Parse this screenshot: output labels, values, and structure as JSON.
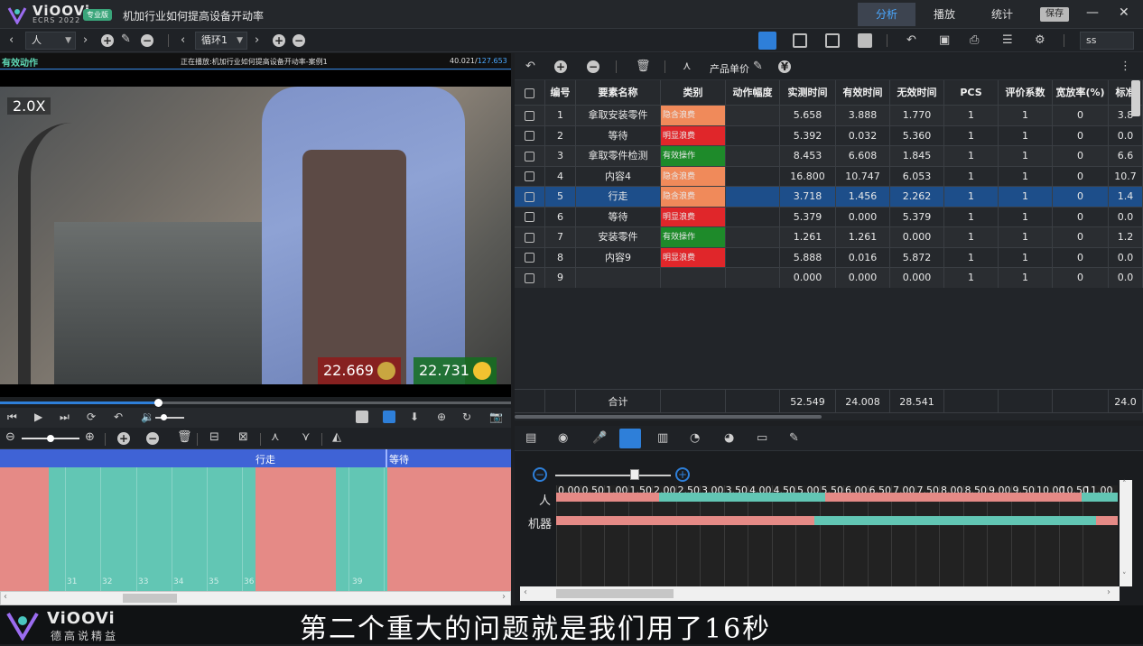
{
  "app": {
    "name": "ViOOVi",
    "subname": "ECRS 2022",
    "edition": "专业版",
    "doc_title": "机加行业如何提高设备开动率"
  },
  "topnav": {
    "analysis": "分析",
    "play": "播放",
    "stats": "统计",
    "save": "保存",
    "minimize": "—",
    "close": "✕"
  },
  "toolbar": {
    "subject": "人",
    "cycle": "循环1",
    "search": "ss"
  },
  "video": {
    "label": "有效动作",
    "playing": "正在播放:机加行业如何提高设备开动率-案例1",
    "time_current": "40.021/",
    "time_total": "127.653",
    "zoom": "2.0X",
    "rating_bad": "22.669",
    "rating_good": "22.731",
    "progress": 0.31
  },
  "table_toolbar": {
    "product_price": "产品单价"
  },
  "table": {
    "headers": [
      "编号",
      "要素名称",
      "类别",
      "动作幅度",
      "实测时间",
      "有效时间",
      "无效时间",
      "PCS",
      "评价系数",
      "宽放率(%)",
      "标准"
    ],
    "rows": [
      {
        "no": "1",
        "name": "拿取安装零件",
        "cat": "隐含浪费",
        "catc": "#f08a5a",
        "measured": "5.658",
        "valid": "3.888",
        "invalid": "1.770",
        "pcs": "1",
        "coef": "1",
        "allow": "0",
        "std": "3.8"
      },
      {
        "no": "2",
        "name": "等待",
        "cat": "明显浪费",
        "catc": "#e0262a",
        "measured": "5.392",
        "valid": "0.032",
        "invalid": "5.360",
        "pcs": "1",
        "coef": "1",
        "allow": "0",
        "std": "0.0"
      },
      {
        "no": "3",
        "name": "拿取零件检测",
        "cat": "有效操作",
        "catc": "#1e8a2a",
        "measured": "8.453",
        "valid": "6.608",
        "invalid": "1.845",
        "pcs": "1",
        "coef": "1",
        "allow": "0",
        "std": "6.6"
      },
      {
        "no": "4",
        "name": "内容4",
        "cat": "隐含浪费",
        "catc": "#f08a5a",
        "measured": "16.800",
        "valid": "10.747",
        "invalid": "6.053",
        "pcs": "1",
        "coef": "1",
        "allow": "0",
        "std": "10.7"
      },
      {
        "no": "5",
        "name": "行走",
        "cat": "隐含浪费",
        "catc": "#f08a5a",
        "measured": "3.718",
        "valid": "1.456",
        "invalid": "2.262",
        "pcs": "1",
        "coef": "1",
        "allow": "0",
        "std": "1.4"
      },
      {
        "no": "6",
        "name": "等待",
        "cat": "明显浪费",
        "catc": "#e0262a",
        "measured": "5.379",
        "valid": "0.000",
        "invalid": "5.379",
        "pcs": "1",
        "coef": "1",
        "allow": "0",
        "std": "0.0"
      },
      {
        "no": "7",
        "name": "安装零件",
        "cat": "有效操作",
        "catc": "#1e8a2a",
        "measured": "1.261",
        "valid": "1.261",
        "invalid": "0.000",
        "pcs": "1",
        "coef": "1",
        "allow": "0",
        "std": "1.2"
      },
      {
        "no": "8",
        "name": "内容9",
        "cat": "明显浪费",
        "catc": "#e0262a",
        "measured": "5.888",
        "valid": "0.016",
        "invalid": "5.872",
        "pcs": "1",
        "coef": "1",
        "allow": "0",
        "std": "0.0"
      },
      {
        "no": "9",
        "name": "",
        "cat": "",
        "catc": "",
        "measured": "0.000",
        "valid": "0.000",
        "invalid": "0.000",
        "pcs": "1",
        "coef": "1",
        "allow": "0",
        "std": "0.0"
      }
    ],
    "selected_row": 4,
    "total": {
      "label": "合计",
      "measured": "52.549",
      "valid": "24.008",
      "invalid": "28.541",
      "std": "24.0"
    }
  },
  "timeline": {
    "labels": [
      {
        "text": "行走"
      },
      {
        "text": "等待"
      }
    ],
    "numbers": [
      "31",
      "32",
      "33",
      "34",
      "35",
      "36",
      "39"
    ]
  },
  "gantt": {
    "row_person": "人",
    "row_machine": "机器",
    "ticks": [
      "0.00",
      "0.50",
      "1.00",
      "1.50",
      "2.00",
      "2.50",
      "3.00",
      "3.50",
      "4.00",
      "4.50",
      "5.00",
      "5.50",
      "6.00",
      "6.50",
      "7.00",
      "7.50",
      "8.00",
      "8.50",
      "9.00",
      "9.50",
      "10.00",
      "10.50",
      "11.00"
    ]
  },
  "footer": {
    "brand": "ViOOVi",
    "slogan": "德高说精益",
    "subtitle": "第二个重大的问题就是我们用了16秒"
  },
  "colors": {
    "accent": "#2e7fd9",
    "valid": "#62c6b4",
    "waste": "#e58a86",
    "selected": "#1d4e8a"
  }
}
